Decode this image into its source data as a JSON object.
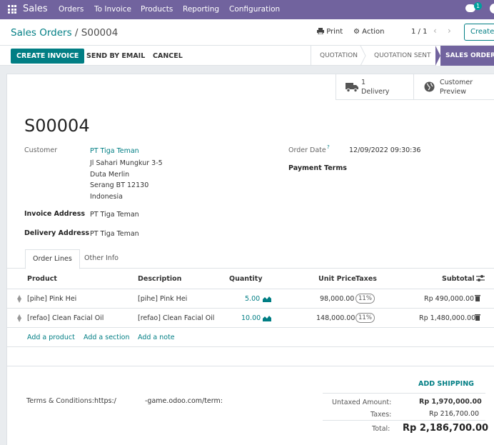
{
  "navbar": {
    "app_name": "Sales",
    "menu": [
      "Orders",
      "To Invoice",
      "Products",
      "Reporting",
      "Configuration"
    ],
    "chat_badge": "1",
    "icons": [
      "apps-grid-icon",
      "chat-icon",
      "avatar"
    ]
  },
  "control_panel": {
    "breadcrumb_parent": "Sales Orders",
    "breadcrumb_sep": "/",
    "breadcrumb_current": "S00004",
    "print_label": "Print",
    "action_label": "Action",
    "pager": "1 / 1",
    "create_label": "Create"
  },
  "statusbar": {
    "buttons": [
      "CREATE INVOICE",
      "SEND BY EMAIL",
      "CANCEL"
    ],
    "stages": [
      "QUOTATION",
      "QUOTATION SENT",
      "SALES ORDER"
    ],
    "active_stage": "SALES ORDER"
  },
  "smart_buttons": {
    "delivery_count": "1",
    "delivery_label": "Delivery",
    "preview_line1": "Customer",
    "preview_line2": "Preview"
  },
  "form": {
    "name": "S00004",
    "customer_label": "Customer",
    "customer_name": "PT Tiga Teman",
    "customer_address": [
      "Jl Sahari Mungkur 3-5",
      "Duta Merlin",
      "Serang BT 12130",
      "Indonesia"
    ],
    "invoice_address_label": "Invoice Address",
    "invoice_address": "PT Tiga Teman",
    "delivery_address_label": "Delivery Address",
    "delivery_address": "PT Tiga Teman",
    "order_date_label": "Order Date",
    "order_date_help": "?",
    "order_date": "12/09/2022 09:30:36",
    "payment_terms_label": "Payment Terms"
  },
  "tabs": [
    "Order Lines",
    "Other Info"
  ],
  "table": {
    "headers": {
      "product": "Product",
      "description": "Description",
      "quantity": "Quantity",
      "unit_price": "Unit Price",
      "taxes": "Taxes",
      "subtotal": "Subtotal"
    },
    "rows": [
      {
        "product": "[pihe] Pink Hei",
        "description": "[pihe] Pink Hei",
        "quantity": "5.00",
        "unit_price": "98,000.00",
        "tax": "11%",
        "subtotal": "Rp 490,000.00"
      },
      {
        "product": "[refao] Clean Facial Oil",
        "description": "[refao] Clean Facial Oil",
        "quantity": "10.00",
        "unit_price": "148,000.00",
        "tax": "11%",
        "subtotal": "Rp 1,480,000.00"
      }
    ],
    "add_product": "Add a product",
    "add_section": "Add a section",
    "add_note": "Add a note"
  },
  "footer": {
    "terms_label": "Terms & Conditions:",
    "terms_prefix": "https:/",
    "terms_suffix": "‑game.odoo.com/term:",
    "add_shipping": "ADD SHIPPING",
    "untaxed_label": "Untaxed Amount:",
    "untaxed_value": "Rp 1,970,000.00",
    "taxes_label": "Taxes:",
    "taxes_value": "Rp 216,700.00",
    "total_label": "Total:",
    "total_value": "Rp 2,186,700.00"
  }
}
